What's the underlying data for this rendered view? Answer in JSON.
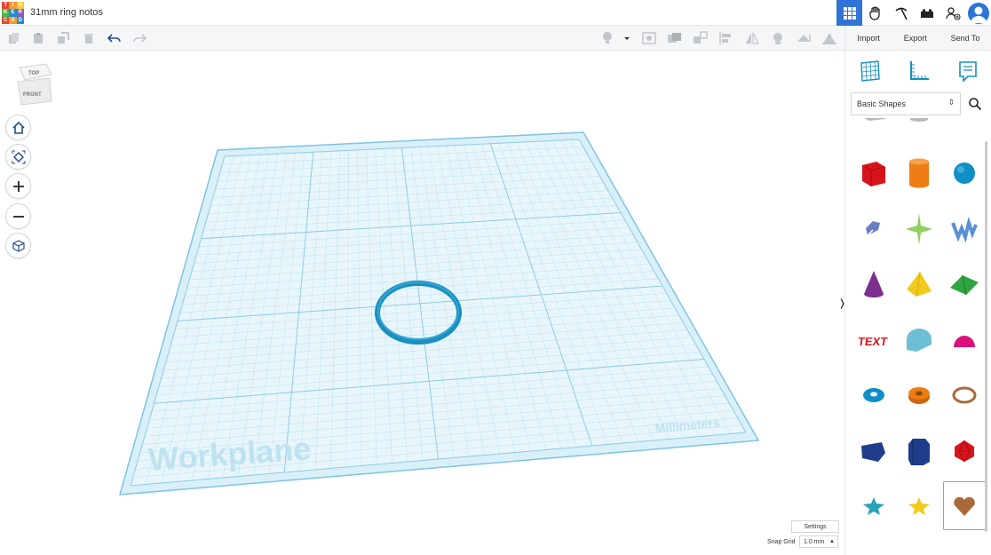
{
  "app": {
    "logo_letters": [
      "T",
      "I",
      "N",
      "K",
      "E",
      "R",
      "C",
      "A",
      "D"
    ],
    "logo_colors": [
      "#e8452c",
      "#f19a31",
      "#f5c93a",
      "#4fb445",
      "#1f8dd6",
      "#8b5ab6",
      "#e8452c",
      "#f19a31",
      "#1f8dd6"
    ],
    "document_title": "31mm ring notos"
  },
  "header": {
    "icons": [
      "3d-design-grid-icon",
      "hand-icon",
      "pickaxe-icon",
      "brick-icon",
      "add-user-icon",
      "user-avatar-icon"
    ]
  },
  "toolbar": {
    "left_icons": [
      "copy-icon",
      "paste-icon",
      "duplicate-icon",
      "delete-icon",
      "undo-icon",
      "redo-icon"
    ],
    "right_icons": [
      "light-bulb-icon",
      "dropdown-icon",
      "hide-icon",
      "group-icon",
      "ungroup-icon",
      "align-icon",
      "mirror-icon",
      "cruise-icon",
      "workplane-icon",
      "ruler-icon"
    ]
  },
  "right_panel": {
    "tabs": {
      "import": "Import",
      "export": "Export",
      "send_to": "Send To"
    },
    "view_icons": [
      "workplane-grid-icon",
      "ruler-icon",
      "notes-icon"
    ],
    "shape_library": "Basic Shapes",
    "shapes": [
      {
        "name": "box-hole",
        "color": "#b7b9bd"
      },
      {
        "name": "cylinder-hole",
        "color": "#b7b9bd"
      },
      {
        "name": "sphere-hole",
        "color": "#b7b9bd"
      },
      {
        "name": "box",
        "color": "#d7141b"
      },
      {
        "name": "cylinder",
        "color": "#ee7d14"
      },
      {
        "name": "sphere",
        "color": "#0f8fc6"
      },
      {
        "name": "scribble",
        "color": "#6a7fc2"
      },
      {
        "name": "graphic",
        "color": "#8fd05e"
      },
      {
        "name": "text-3d",
        "color": "#5a8fd6"
      },
      {
        "name": "cone",
        "color": "#7d2f8e"
      },
      {
        "name": "pyramid",
        "color": "#f2ca1d"
      },
      {
        "name": "roof",
        "color": "#2ea640"
      },
      {
        "name": "text",
        "color": "#d7141b"
      },
      {
        "name": "round-roof",
        "color": "#6cbfd4"
      },
      {
        "name": "half-sphere",
        "color": "#d8127a"
      },
      {
        "name": "torus",
        "color": "#0f8fc6"
      },
      {
        "name": "tube",
        "color": "#ee7d14"
      },
      {
        "name": "ring",
        "color": "#a86a3a"
      },
      {
        "name": "wedge",
        "color": "#1f3d8a"
      },
      {
        "name": "polygon",
        "color": "#1f3d8a"
      },
      {
        "name": "icosahedron",
        "color": "#d7141b"
      },
      {
        "name": "star",
        "color": "#2aa3b8"
      },
      {
        "name": "star-gold",
        "color": "#f2ca1d"
      },
      {
        "name": "heart",
        "color": "#a86a3a"
      }
    ]
  },
  "viewcube": {
    "top": "TOP",
    "front": "FRONT"
  },
  "nav_buttons": [
    "home-icon",
    "fit-view-icon",
    "zoom-in-icon",
    "zoom-out-icon",
    "perspective-icon"
  ],
  "workplane": {
    "label": "Workplane",
    "units": "Millimeters",
    "grid_color": "#5fb8e0",
    "plane_color": "#daf0f8",
    "ring_color": "#1a8fc0"
  },
  "bottom": {
    "settings": "Settings",
    "snap_label": "Snap Grid",
    "snap_value": "1.0 mm"
  }
}
